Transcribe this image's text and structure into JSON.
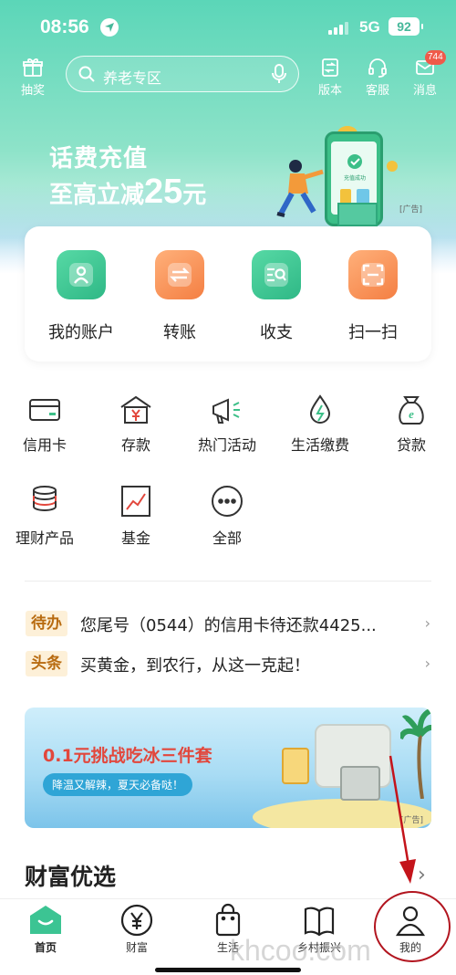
{
  "status_bar": {
    "time": "08:56",
    "network": "5G",
    "battery": "92"
  },
  "header": {
    "lottery_label": "抽奖",
    "search_placeholder": "养老专区",
    "version_label": "版本",
    "service_label": "客服",
    "message_label": "消息",
    "message_badge": "744"
  },
  "banner": {
    "line1": "话费充值",
    "line2_prefix": "至高立减",
    "line2_amount": "25",
    "line2_suffix": "元",
    "ad_tag": "[广告]",
    "phone_caption": "充值成功"
  },
  "quick_actions": [
    {
      "label": "我的账户",
      "icon": "account-icon",
      "color": "#3cc493"
    },
    {
      "label": "转账",
      "icon": "transfer-icon",
      "color": "#f58a4e"
    },
    {
      "label": "收支",
      "icon": "income-expense-icon",
      "color": "#3cc493"
    },
    {
      "label": "扫一扫",
      "icon": "scan-icon",
      "color": "#f58a4e"
    }
  ],
  "services": [
    {
      "label": "信用卡",
      "icon": "credit-card-icon"
    },
    {
      "label": "存款",
      "icon": "deposit-icon"
    },
    {
      "label": "热门活动",
      "icon": "megaphone-icon"
    },
    {
      "label": "生活缴费",
      "icon": "utility-payment-icon"
    },
    {
      "label": "贷款",
      "icon": "loan-bag-icon"
    },
    {
      "label": "理财产品",
      "icon": "wealth-coins-icon"
    },
    {
      "label": "基金",
      "icon": "fund-chart-icon"
    },
    {
      "label": "全部",
      "icon": "more-icon"
    }
  ],
  "notices": [
    {
      "tag": "待办",
      "text": "您尾号（0544）的信用卡待还款4425..."
    },
    {
      "tag": "头条",
      "text": "买黄金，到农行，从这一克起！"
    }
  ],
  "promo": {
    "title": "0.1元挑战吃冰三件套",
    "pill": "降温又解辣，夏天必备哒！",
    "ad_tag": "[广告]"
  },
  "section": {
    "title": "财富优选"
  },
  "bottom_nav": [
    {
      "label": "首页",
      "icon": "home-icon",
      "active": true
    },
    {
      "label": "财富",
      "icon": "yen-icon",
      "active": false
    },
    {
      "label": "生活",
      "icon": "shopping-bag-icon",
      "active": false
    },
    {
      "label": "乡村振兴",
      "icon": "book-icon",
      "active": false
    },
    {
      "label": "我的",
      "icon": "person-icon",
      "active": false
    }
  ],
  "watermark": "khcoo.com",
  "colors": {
    "brand_green": "#2fb886",
    "accent_orange": "#f47f43",
    "annotation_red": "#b2151f"
  }
}
